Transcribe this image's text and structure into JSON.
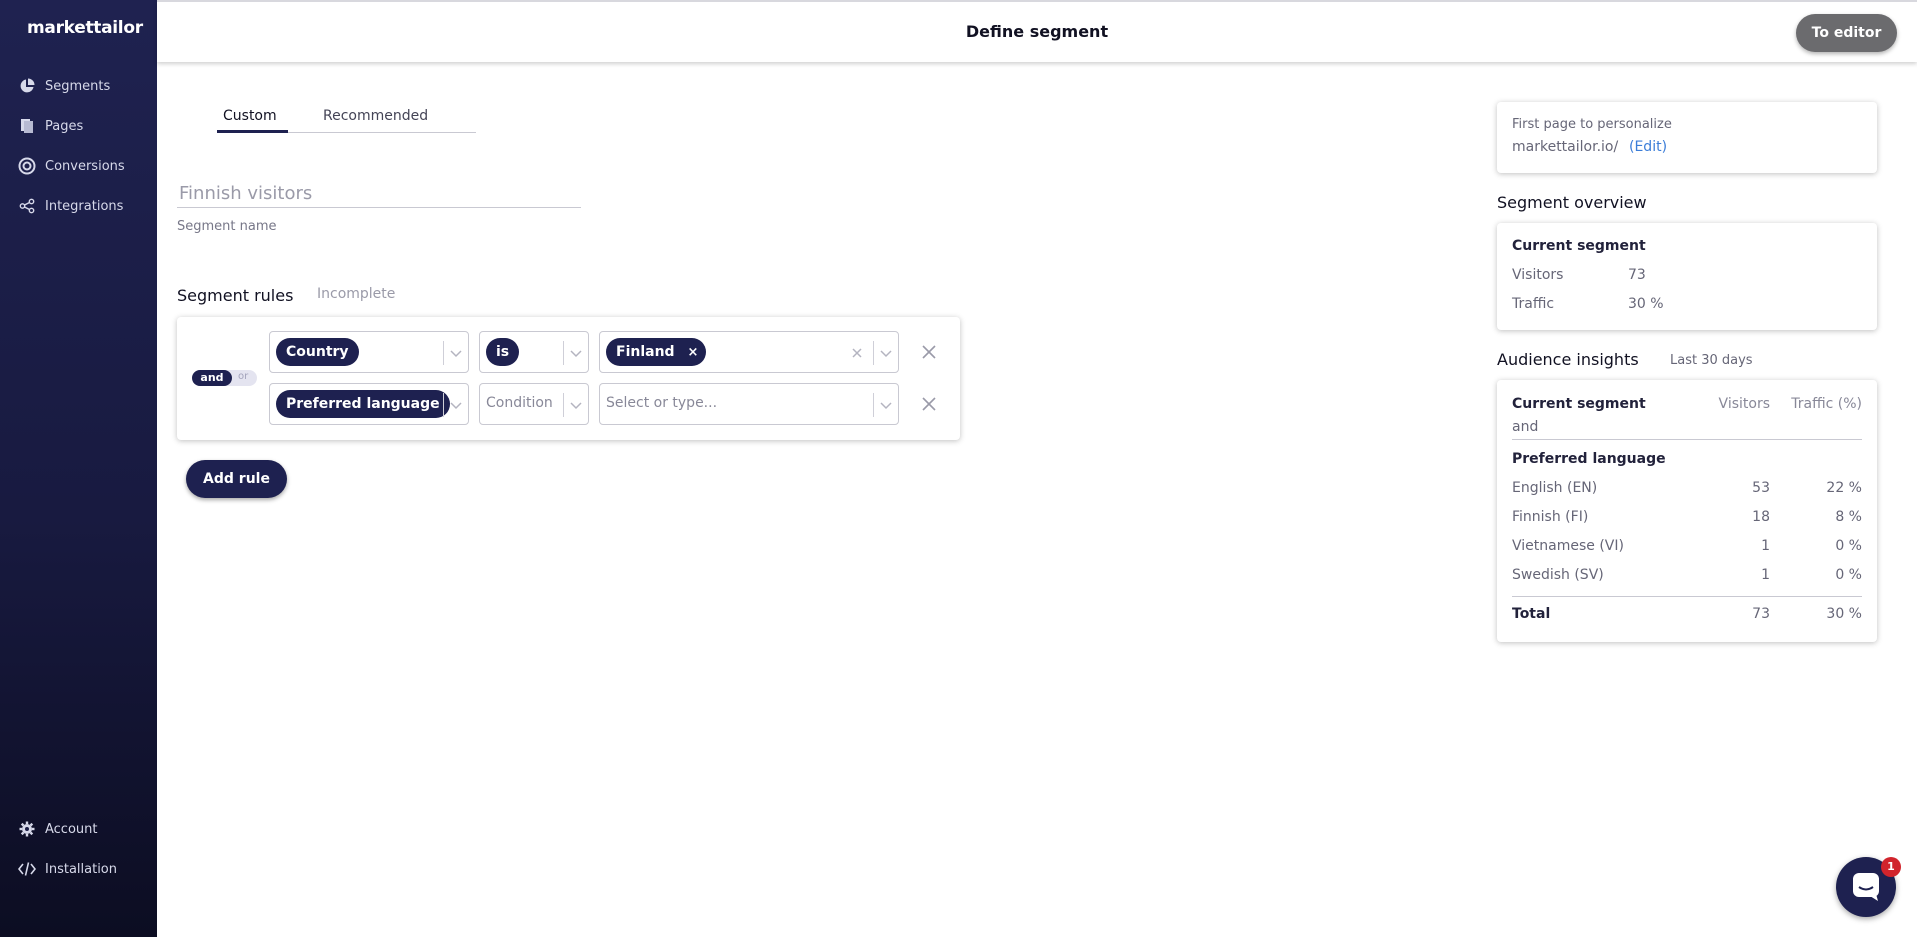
{
  "brand": {
    "logo_text": "markettailor"
  },
  "sidebar": {
    "items": [
      {
        "label": "Segments",
        "icon": "pie-chart-icon"
      },
      {
        "label": "Pages",
        "icon": "pages-icon"
      },
      {
        "label": "Conversions",
        "icon": "target-icon"
      },
      {
        "label": "Integrations",
        "icon": "share-nodes-icon"
      }
    ],
    "bottom_items": [
      {
        "label": "Account",
        "icon": "gear-icon"
      },
      {
        "label": "Installation",
        "icon": "code-icon"
      }
    ]
  },
  "header": {
    "title": "Define segment",
    "to_editor_label": "To editor"
  },
  "tabs": [
    {
      "label": "Custom",
      "active": true
    },
    {
      "label": "Recommended",
      "active": false
    }
  ],
  "segment": {
    "name_value": "Finnish visitors",
    "name_label": "Segment name"
  },
  "rules": {
    "title": "Segment rules",
    "status": "Incomplete",
    "logic": {
      "and_label": "and",
      "or_label": "or",
      "selected": "and"
    },
    "rows": [
      {
        "attribute": "Country",
        "condition": "is",
        "value": "Finland",
        "value_remove": "×"
      },
      {
        "attribute": "Preferred language",
        "condition_placeholder": "Condition",
        "value_placeholder": "Select or type..."
      }
    ],
    "add_rule_label": "Add rule"
  },
  "right": {
    "first_page": {
      "label": "First page to personalize",
      "url": "markettailor.io/",
      "edit_label": "(Edit)"
    },
    "overview": {
      "title": "Segment overview",
      "current_label": "Current segment",
      "visitors_label": "Visitors",
      "visitors_value": "73",
      "traffic_label": "Traffic",
      "traffic_value": "30 %"
    },
    "insights": {
      "title": "Audience insights",
      "period": "Last 30 days",
      "col_segment": "Current segment",
      "col_segment_sub": "and",
      "col_visitors": "Visitors",
      "col_traffic": "Traffic (%)",
      "group_label": "Preferred language",
      "rows": [
        {
          "label": "English (EN)",
          "visitors": "53",
          "traffic": "22 %"
        },
        {
          "label": "Finnish (FI)",
          "visitors": "18",
          "traffic": "8 %"
        },
        {
          "label": "Vietnamese (VI)",
          "visitors": "1",
          "traffic": "0 %"
        },
        {
          "label": "Swedish (SV)",
          "visitors": "1",
          "traffic": "0 %"
        }
      ],
      "total": {
        "label": "Total",
        "visitors": "73",
        "traffic": "30 %"
      }
    }
  },
  "chat": {
    "badge": "1",
    "icon": "chat-icon"
  },
  "colors": {
    "navy": "#1e2150",
    "sidebar_top": "#1f2250",
    "sidebar_bottom": "#0c0d22",
    "badge_red": "#d1242c",
    "link_blue": "#3b7dd8",
    "editor_gray": "#6b6b6e"
  }
}
